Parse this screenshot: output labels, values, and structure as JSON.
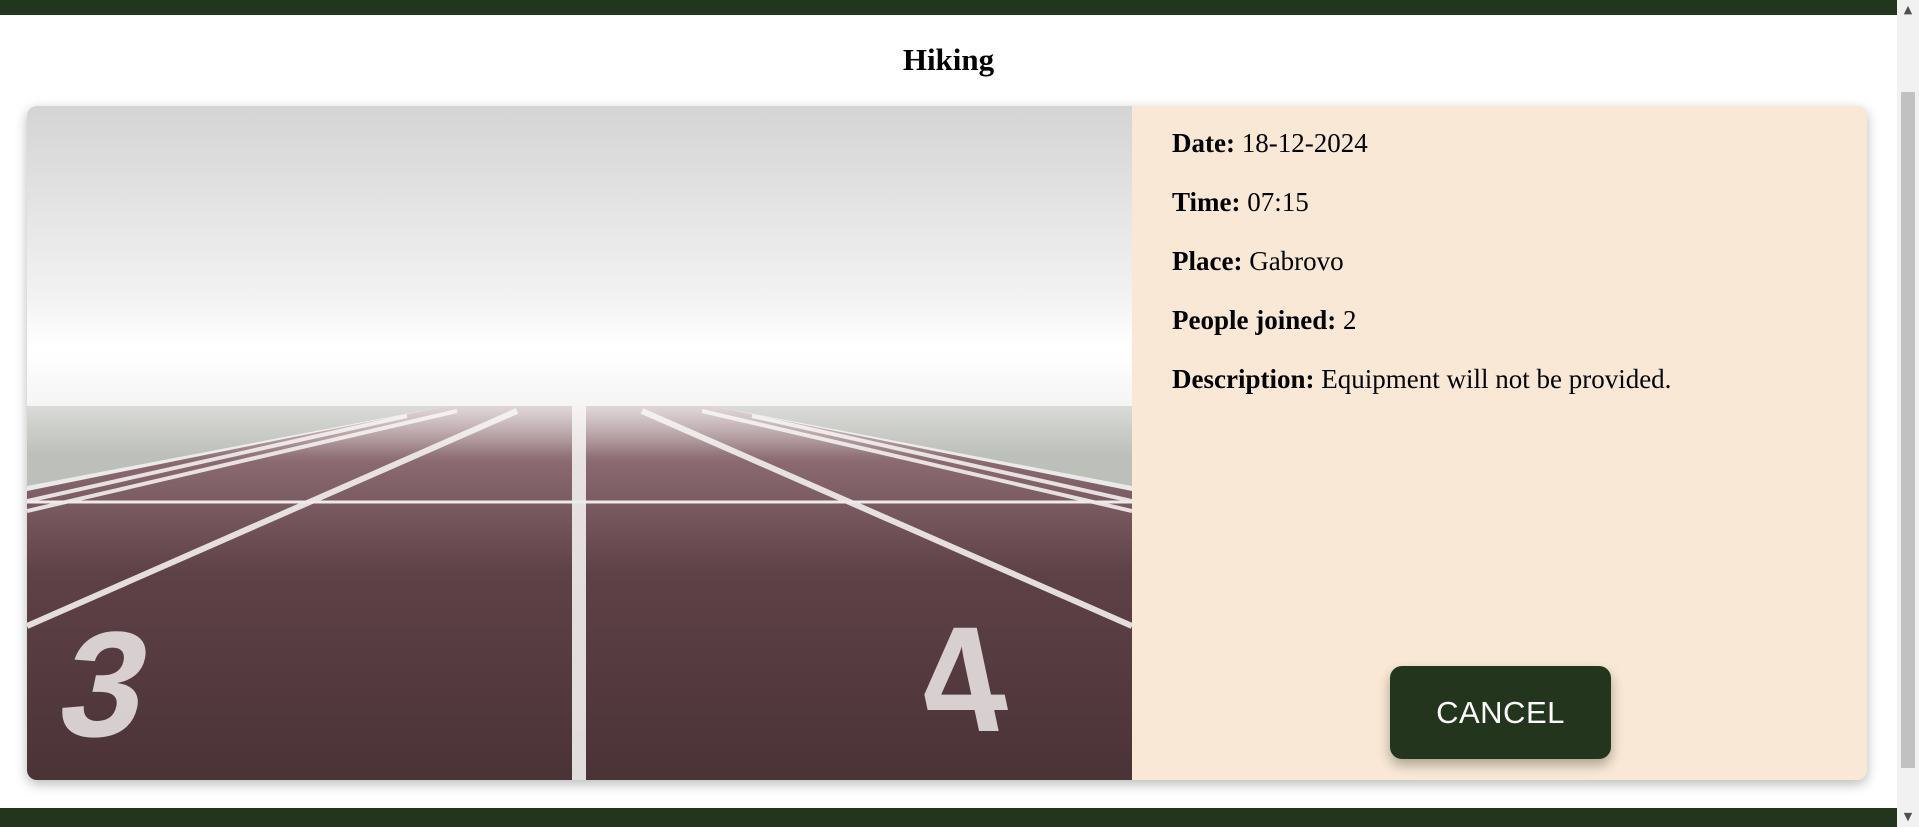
{
  "page": {
    "title": "Hiking",
    "colors": {
      "header_bar": "#23361d",
      "details_bg": "#f8e8d5",
      "button_bg": "#23361d"
    }
  },
  "event": {
    "image_icon": "running-track-photo",
    "details": {
      "date": {
        "label": "Date:",
        "value": "18-12-2024"
      },
      "time": {
        "label": "Time:",
        "value": "07:15"
      },
      "place": {
        "label": "Place:",
        "value": "Gabrovo"
      },
      "people": {
        "label": "People joined:",
        "value": "2"
      },
      "description": {
        "label": "Description:",
        "value": "Equipment will not be provided."
      }
    },
    "cancel_label": "CANCEL"
  },
  "scrollbar": {
    "up_icon": "▲",
    "down_icon": "▼"
  }
}
